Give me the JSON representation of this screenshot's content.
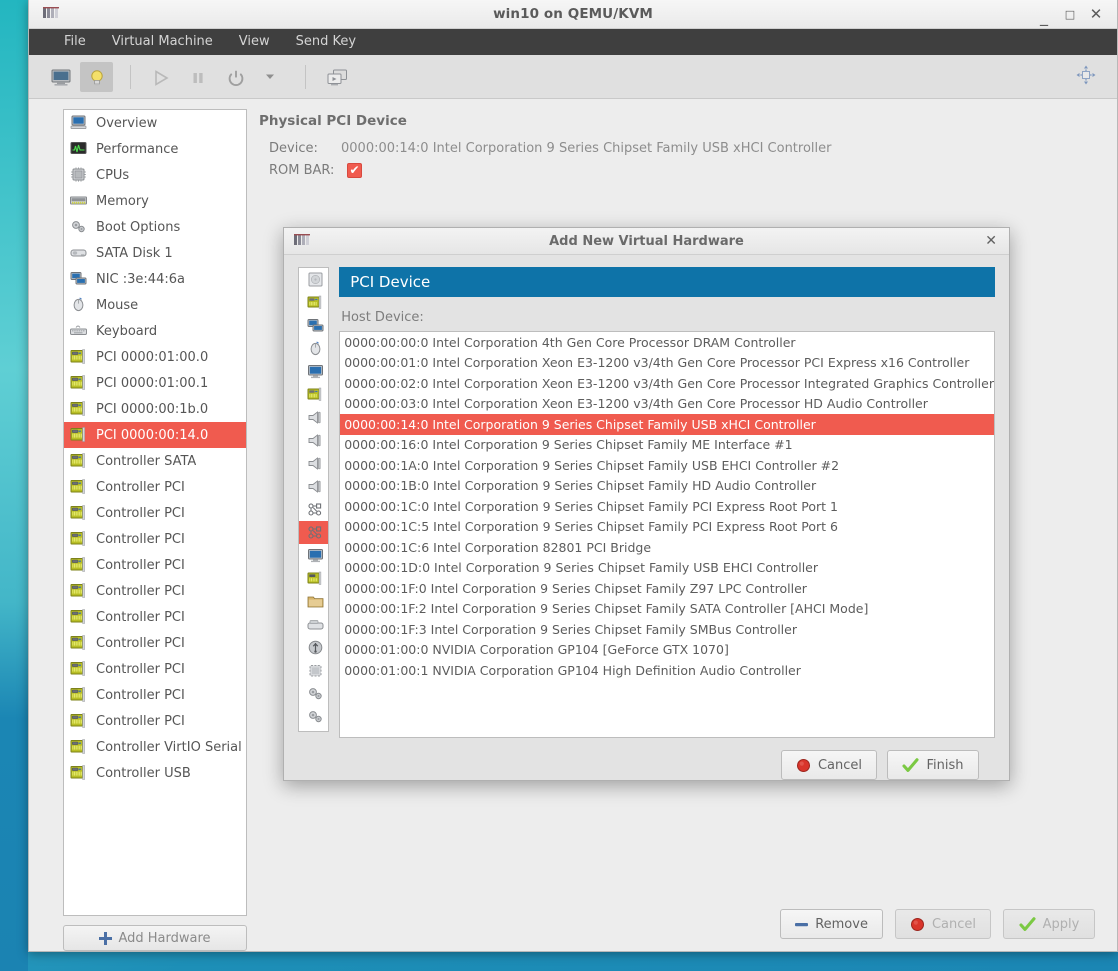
{
  "window": {
    "title": "win10 on QEMU/KVM",
    "app_icon": "virt-manager-icon",
    "minimize": "_",
    "maximize": "□",
    "close": "✕"
  },
  "menubar": {
    "items": [
      {
        "label": "File",
        "name": "menu-file"
      },
      {
        "label": "Virtual Machine",
        "name": "menu-virtual-machine"
      },
      {
        "label": "View",
        "name": "menu-view"
      },
      {
        "label": "Send Key",
        "name": "menu-send-key"
      }
    ]
  },
  "toolbar": {
    "buttons": [
      {
        "name": "show-console-button",
        "icon": "monitor-icon",
        "active": false
      },
      {
        "name": "show-details-button",
        "icon": "lightbulb-icon",
        "active": true
      },
      {
        "name": "run-button",
        "icon": "play-icon",
        "active": false
      },
      {
        "name": "pause-button",
        "icon": "pause-icon",
        "active": false
      },
      {
        "name": "shutdown-button",
        "icon": "power-icon",
        "active": false
      },
      {
        "name": "shutdown-menu-button",
        "icon": "chevron-down-icon",
        "active": false
      },
      {
        "name": "snapshots-button",
        "icon": "screens-icon",
        "active": false
      }
    ],
    "fullscreen_icon": "fullscreen-arrows-icon"
  },
  "sidebar": {
    "items": [
      {
        "label": "Overview",
        "icon": "computer-icon",
        "selected": false
      },
      {
        "label": "Performance",
        "icon": "graph-icon",
        "selected": false
      },
      {
        "label": "CPUs",
        "icon": "cpu-icon",
        "selected": false
      },
      {
        "label": "Memory",
        "icon": "memory-icon",
        "selected": false
      },
      {
        "label": "Boot Options",
        "icon": "gears-icon",
        "selected": false
      },
      {
        "label": "SATA Disk 1",
        "icon": "harddisk-icon",
        "selected": false
      },
      {
        "label": "NIC :3e:44:6a",
        "icon": "network-icon",
        "selected": false
      },
      {
        "label": "Mouse",
        "icon": "mouse-icon",
        "selected": false
      },
      {
        "label": "Keyboard",
        "icon": "keyboard-icon",
        "selected": false
      },
      {
        "label": "PCI 0000:01:00.0",
        "icon": "pci-card-icon",
        "selected": false
      },
      {
        "label": "PCI 0000:01:00.1",
        "icon": "pci-card-icon",
        "selected": false
      },
      {
        "label": "PCI 0000:00:1b.0",
        "icon": "pci-card-icon",
        "selected": false
      },
      {
        "label": "PCI 0000:00:14.0",
        "icon": "pci-card-icon",
        "selected": true
      },
      {
        "label": "Controller SATA",
        "icon": "pci-card-icon",
        "selected": false
      },
      {
        "label": "Controller PCI",
        "icon": "pci-card-icon",
        "selected": false
      },
      {
        "label": "Controller PCI",
        "icon": "pci-card-icon",
        "selected": false
      },
      {
        "label": "Controller PCI",
        "icon": "pci-card-icon",
        "selected": false
      },
      {
        "label": "Controller PCI",
        "icon": "pci-card-icon",
        "selected": false
      },
      {
        "label": "Controller PCI",
        "icon": "pci-card-icon",
        "selected": false
      },
      {
        "label": "Controller PCI",
        "icon": "pci-card-icon",
        "selected": false
      },
      {
        "label": "Controller PCI",
        "icon": "pci-card-icon",
        "selected": false
      },
      {
        "label": "Controller PCI",
        "icon": "pci-card-icon",
        "selected": false
      },
      {
        "label": "Controller PCI",
        "icon": "pci-card-icon",
        "selected": false
      },
      {
        "label": "Controller PCI",
        "icon": "pci-card-icon",
        "selected": false
      },
      {
        "label": "Controller VirtIO Serial",
        "icon": "pci-card-icon",
        "selected": false
      },
      {
        "label": "Controller USB",
        "icon": "pci-card-icon",
        "selected": false
      }
    ],
    "add_hardware_label": "Add Hardware",
    "add_hardware_icon": "plus-icon"
  },
  "details": {
    "panel_title": "Physical PCI Device",
    "device_key": "Device:",
    "device_value": "0000:00:14:0 Intel Corporation 9 Series Chipset Family USB xHCI Controller",
    "rom_bar_key": "ROM BAR:",
    "rom_bar_checked": true,
    "checkmark": "✔"
  },
  "main_buttons": [
    {
      "label": "Remove",
      "name": "remove-button",
      "icon": "minus-icon",
      "disabled": false
    },
    {
      "label": "Cancel",
      "name": "cancel-button",
      "icon": "stop-icon",
      "disabled": true
    },
    {
      "label": "Apply",
      "name": "apply-button",
      "icon": "check-icon",
      "disabled": true
    }
  ],
  "dialog": {
    "title": "Add New Virtual Hardware",
    "icon": "virt-manager-icon",
    "close": "✕",
    "banner": "PCI Device",
    "host_device_label": "Host Device:",
    "categories": [
      {
        "label": "Storage",
        "icon": "storage-icon",
        "selected": false
      },
      {
        "label": "Controller",
        "icon": "controller-icon",
        "selected": false
      },
      {
        "label": "Network",
        "icon": "network-icon",
        "selected": false
      },
      {
        "label": "Input",
        "icon": "mouse-icon",
        "selected": false
      },
      {
        "label": "Graphics",
        "icon": "monitor-icon",
        "selected": false
      },
      {
        "label": "Sound",
        "icon": "sound-card-icon",
        "selected": false
      },
      {
        "label": "Serial",
        "icon": "serial-port-icon",
        "selected": false
      },
      {
        "label": "Parallel",
        "icon": "serial-port-icon",
        "selected": false
      },
      {
        "label": "Console",
        "icon": "serial-port-icon",
        "selected": false
      },
      {
        "label": "Channel",
        "icon": "serial-port-icon",
        "selected": false
      },
      {
        "label": "USB Host Device",
        "icon": "usb-host-icon",
        "selected": false
      },
      {
        "label": "PCI Host Device",
        "icon": "pci-host-icon",
        "selected": true
      },
      {
        "label": "Video",
        "icon": "monitor-icon",
        "selected": false
      },
      {
        "label": "Watchdog",
        "icon": "watchdog-icon",
        "selected": false
      },
      {
        "label": "Filesystem",
        "icon": "folder-icon",
        "selected": false
      },
      {
        "label": "Smartcard",
        "icon": "smartcard-icon",
        "selected": false
      },
      {
        "label": "USB Redirection",
        "icon": "usb-icon",
        "selected": false
      },
      {
        "label": "TPM",
        "icon": "chip-icon",
        "selected": false
      },
      {
        "label": "RNG",
        "icon": "gears-icon",
        "selected": false
      },
      {
        "label": "Panic Notifier",
        "icon": "gears-icon",
        "selected": false
      }
    ],
    "host_devices": [
      {
        "label": "0000:00:00:0 Intel Corporation 4th Gen Core Processor DRAM Controller",
        "selected": false
      },
      {
        "label": "0000:00:01:0 Intel Corporation Xeon E3-1200 v3/4th Gen Core Processor PCI Express x16 Controller",
        "selected": false
      },
      {
        "label": "0000:00:02:0 Intel Corporation Xeon E3-1200 v3/4th Gen Core Processor Integrated Graphics Controller",
        "selected": false
      },
      {
        "label": "0000:00:03:0 Intel Corporation Xeon E3-1200 v3/4th Gen Core Processor HD Audio Controller",
        "selected": false
      },
      {
        "label": "0000:00:14:0 Intel Corporation 9 Series Chipset Family USB xHCI Controller",
        "selected": true
      },
      {
        "label": "0000:00:16:0 Intel Corporation 9 Series Chipset Family ME Interface #1",
        "selected": false
      },
      {
        "label": "0000:00:1A:0 Intel Corporation 9 Series Chipset Family USB EHCI Controller #2",
        "selected": false
      },
      {
        "label": "0000:00:1B:0 Intel Corporation 9 Series Chipset Family HD Audio Controller",
        "selected": false
      },
      {
        "label": "0000:00:1C:0 Intel Corporation 9 Series Chipset Family PCI Express Root Port 1",
        "selected": false
      },
      {
        "label": "0000:00:1C:5 Intel Corporation 9 Series Chipset Family PCI Express Root Port 6",
        "selected": false
      },
      {
        "label": "0000:00:1C:6 Intel Corporation 82801 PCI Bridge",
        "selected": false
      },
      {
        "label": "0000:00:1D:0 Intel Corporation 9 Series Chipset Family USB EHCI Controller",
        "selected": false
      },
      {
        "label": "0000:00:1F:0 Intel Corporation 9 Series Chipset Family Z97 LPC Controller",
        "selected": false
      },
      {
        "label": "0000:00:1F:2 Intel Corporation 9 Series Chipset Family SATA Controller [AHCI Mode]",
        "selected": false
      },
      {
        "label": "0000:00:1F:3 Intel Corporation 9 Series Chipset Family SMBus Controller",
        "selected": false
      },
      {
        "label": "0000:01:00:0 NVIDIA Corporation GP104 [GeForce GTX 1070]",
        "selected": false
      },
      {
        "label": "0000:01:00:1 NVIDIA Corporation GP104 High Definition Audio Controller",
        "selected": false
      }
    ],
    "buttons": [
      {
        "label": "Cancel",
        "name": "dialog-cancel-button",
        "icon": "stop-icon",
        "disabled": false
      },
      {
        "label": "Finish",
        "name": "dialog-finish-button",
        "icon": "check-icon",
        "disabled": false
      }
    ]
  },
  "colors": {
    "selection_red": "#f05b4f",
    "banner_blue": "#0e73a8",
    "menubar_dark": "#3f3f3f",
    "window_bg": "#ededed"
  }
}
